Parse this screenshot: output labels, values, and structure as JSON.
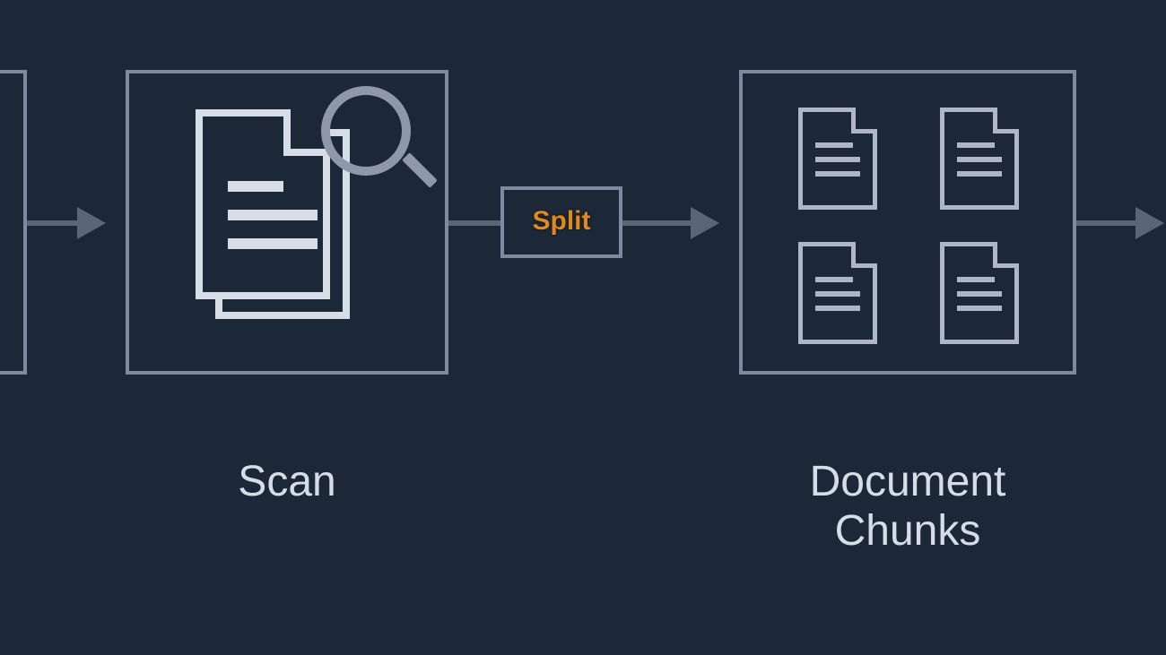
{
  "colors": {
    "background": "#1c2838",
    "stroke": "#7d8aa0",
    "arrow": "#5a6576",
    "text": "#d7dde6",
    "accent": "#e08a1e",
    "icon": "#aeb6c7",
    "iconBright": "#d7dde6"
  },
  "nodes": {
    "input": {
      "label": ""
    },
    "scan": {
      "label": "Scan"
    },
    "split": {
      "label": "Split"
    },
    "chunks": {
      "label": "Document Chunks"
    }
  }
}
